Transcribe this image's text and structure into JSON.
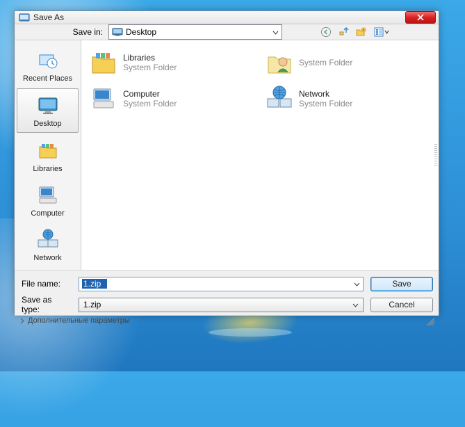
{
  "titlebar": {
    "title": "Save As"
  },
  "toolbar": {
    "save_in_label": "Save in:",
    "save_in_value": "Desktop"
  },
  "sidebar": {
    "items": [
      {
        "label": "Recent Places",
        "selected": false
      },
      {
        "label": "Desktop",
        "selected": true
      },
      {
        "label": "Libraries",
        "selected": false
      },
      {
        "label": "Computer",
        "selected": false
      },
      {
        "label": "Network",
        "selected": false
      }
    ]
  },
  "files": [
    {
      "name": "Libraries",
      "sub": "System Folder"
    },
    {
      "name": "",
      "sub": "System Folder"
    },
    {
      "name": "Computer",
      "sub": "System Folder"
    },
    {
      "name": "Network",
      "sub": "System Folder"
    }
  ],
  "form": {
    "file_name_label": "File name:",
    "file_name_value": "1.zip",
    "save_type_label": "Save as type:",
    "save_type_value": "1.zip",
    "save_btn": "Save",
    "cancel_btn": "Cancel"
  },
  "status": {
    "expand_label": "Дополнительные параметры"
  }
}
